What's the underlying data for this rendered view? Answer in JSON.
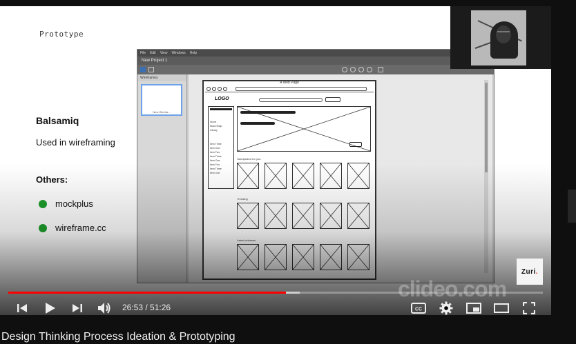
{
  "slide": {
    "heading": "Prototype",
    "tool_name": "Balsamiq",
    "tool_desc": "Used in wireframing",
    "others_heading": "Others:",
    "others": [
      "mockplus",
      "wireframe.cc"
    ]
  },
  "app_window": {
    "menu": [
      "File",
      "Edit",
      "View",
      "Windows",
      "Help"
    ],
    "title": "New Project 1",
    "panel_title": "Wireframes",
    "thumb_label": "New Wirefra...",
    "mock_title": "A Web Page",
    "mock_logo": "LOGO",
    "sidebar_items": [
      "Home",
      "Mock Shop",
      "Library",
      "Item Three",
      "Item One",
      "Item Two",
      "Item Three",
      "Item One",
      "Item Two",
      "Item Three",
      "Item One"
    ],
    "section_labels": [
      "Handpicked for you",
      "Trending",
      "Latest releases"
    ]
  },
  "overlay": {
    "brand": "Zuri",
    "brand_dot": ".",
    "watermark": "clideo.com"
  },
  "player": {
    "current_time": "26:53",
    "duration": "51:26",
    "time_display": "26:53 / 51:26",
    "progress_fraction": 0.52,
    "buffered_fraction": 0.545,
    "cc_label": "CC"
  },
  "colors": {
    "progress": "#ff0000",
    "bullet": "#1f9e2c"
  },
  "video": {
    "title": "Design Thinking Process Ideation & Prototyping"
  }
}
